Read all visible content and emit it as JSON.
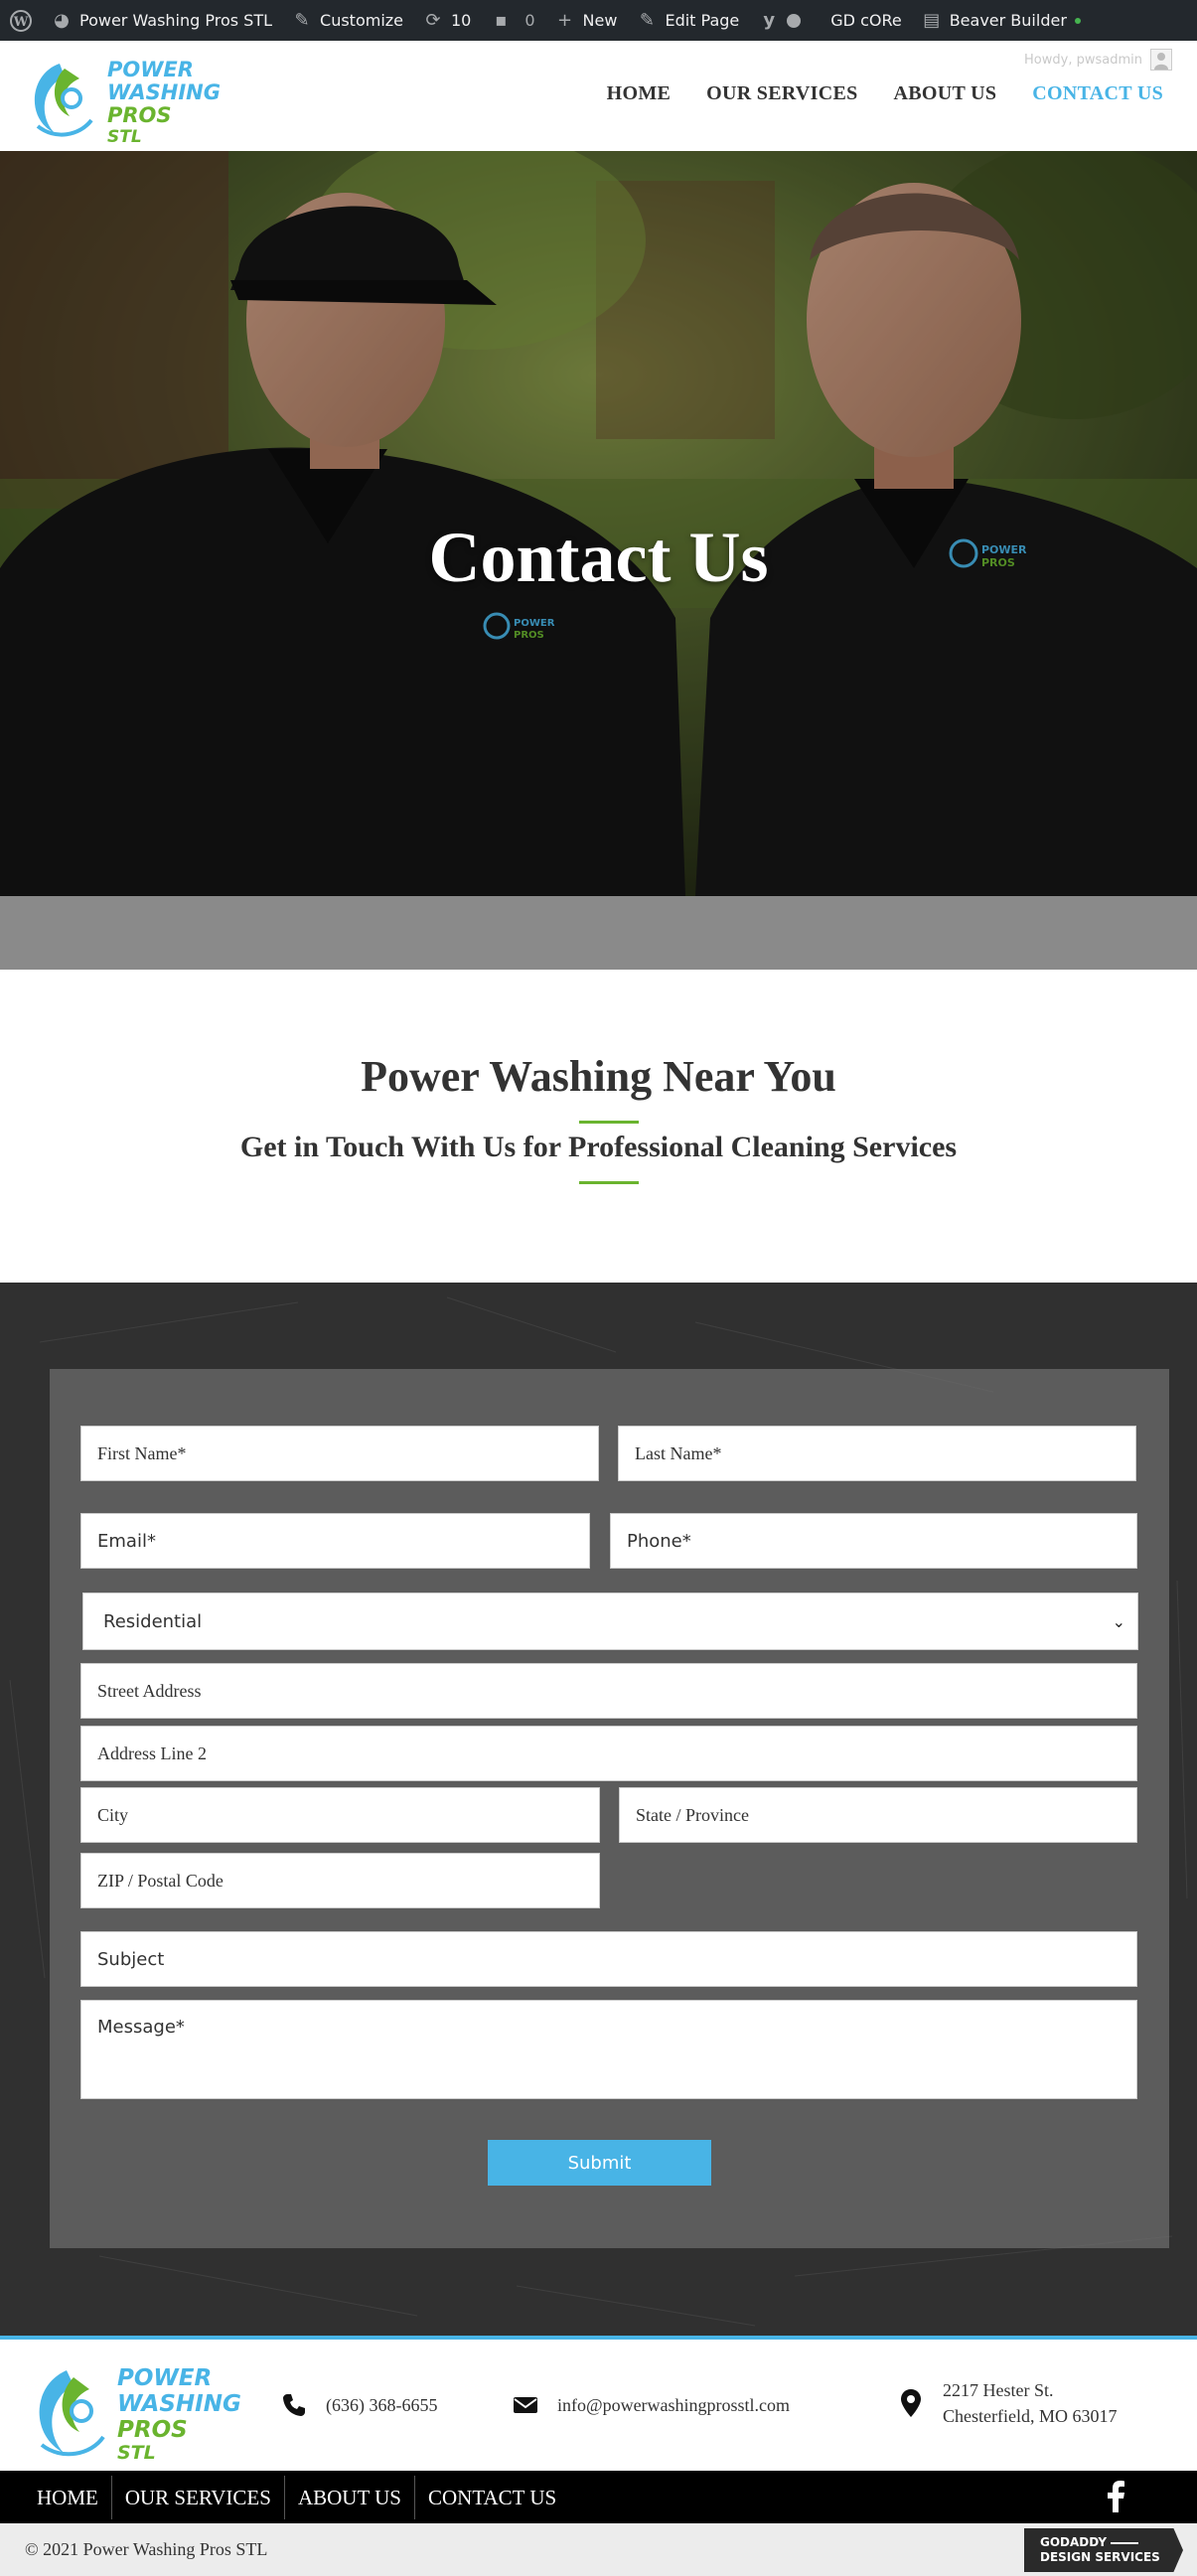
{
  "adminbar": {
    "site_name": "Power Washing Pros STL",
    "customize": "Customize",
    "updates_count": "10",
    "comments_count": "0",
    "new": "New",
    "edit_page": "Edit Page",
    "gd_core": "GD cORe",
    "beaver_builder": "Beaver Builder",
    "howdy": "Howdy, pwsadmin"
  },
  "brand": {
    "logo_line1": "POWER",
    "logo_line2": "WASHING",
    "logo_line3": "PROS",
    "logo_line4": "STL",
    "accent_blue": "#48b4e6",
    "accent_green": "#6ab42f",
    "dark": "#333333"
  },
  "nav": {
    "items": [
      {
        "label": "HOME",
        "active": false
      },
      {
        "label": "OUR SERVICES",
        "active": false
      },
      {
        "label": "ABOUT US",
        "active": false
      },
      {
        "label": "CONTACT US",
        "active": true
      }
    ]
  },
  "hero": {
    "title": "Contact Us"
  },
  "intro": {
    "heading": "Power Washing Near You",
    "subheading": "Get in Touch With Us for Professional Cleaning Services"
  },
  "form": {
    "first_name": "First Name*",
    "last_name": "Last Name*",
    "email": "Email*",
    "phone": "Phone*",
    "property_type": "Residential",
    "street_address": "Street Address",
    "address_line2": "Address Line 2",
    "city": "City",
    "state": "State / Province",
    "zip": "ZIP / Postal Code",
    "subject": "Subject",
    "message": "Message*",
    "submit": "Submit"
  },
  "footer": {
    "phone": "(636) 368-6655",
    "email": "info@powerwashingprosstl.com",
    "address_line1": "2217 Hester St.",
    "address_line2": "Chesterfield, MO 63017",
    "nav": [
      "HOME",
      "OUR SERVICES",
      "ABOUT US",
      "CONTACT US"
    ],
    "copyright": "© 2021 Power Washing Pros STL",
    "badge_line1": "GODADDY",
    "badge_line2": "DESIGN SERVICES"
  }
}
